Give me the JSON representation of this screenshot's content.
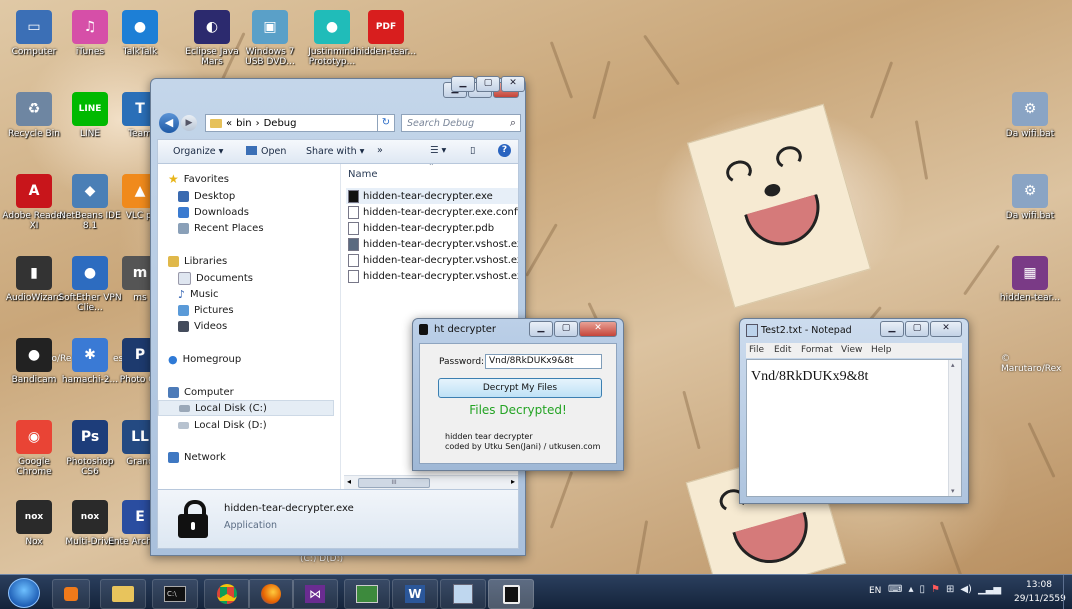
{
  "desktop_icons": [
    {
      "label": "Computer",
      "color": "#3b6fb6",
      "glyph": "▭"
    },
    {
      "label": "iTunes",
      "color": "#d64fa8",
      "glyph": "♫"
    },
    {
      "label": "TalkTalk",
      "color": "#1d7fd6",
      "glyph": "●"
    },
    {
      "label": "Eclipse Java Mars",
      "color": "#2c2a6e",
      "glyph": "◐"
    },
    {
      "label": "Windows 7 USB DVD...",
      "color": "#5aa0c8",
      "glyph": "▣"
    },
    {
      "label": "Justinmind Prototyp...",
      "color": "#20bcb9",
      "glyph": "●"
    },
    {
      "label": "hidden-tear...",
      "color": "#d81e1e",
      "glyph": "PDF"
    },
    {
      "label": "Recycle Bin",
      "color": "#6e86a2",
      "glyph": "♻"
    },
    {
      "label": "LINE",
      "color": "#00b900",
      "glyph": "LINE"
    },
    {
      "label": "Team",
      "color": "#2a6fb8",
      "glyph": "T"
    },
    {
      "label": "Adobe Reader XI",
      "color": "#c8151b",
      "glyph": "A"
    },
    {
      "label": "NetBeans IDE 8.1",
      "color": "#4a7fb6",
      "glyph": "◆"
    },
    {
      "label": "VLC pl",
      "color": "#f08a1c",
      "glyph": "▲"
    },
    {
      "label": "AudioWizard",
      "color": "#333333",
      "glyph": "▮"
    },
    {
      "label": "SoftEther VPN Clie...",
      "color": "#2d6cc0",
      "glyph": "●"
    },
    {
      "label": "ms",
      "color": "#555555",
      "glyph": "m"
    },
    {
      "label": "Bandicam",
      "color": "#222222",
      "glyph": "●"
    },
    {
      "label": "hamachi-2...",
      "color": "#3a7ad5",
      "glyph": "✱"
    },
    {
      "label": "Photo CS",
      "color": "#1d3a6e",
      "glyph": "P"
    },
    {
      "label": "Google Chrome",
      "color": "#e94435",
      "glyph": "◉"
    },
    {
      "label": "Photoshop CS6",
      "color": "#1d3d7a",
      "glyph": "Ps"
    },
    {
      "label": "Grand",
      "color": "#244a82",
      "glyph": "LL"
    },
    {
      "label": "Nox",
      "color": "#2a2a2a",
      "glyph": "nox"
    },
    {
      "label": "Multi-Drive",
      "color": "#2a2a2a",
      "glyph": "nox"
    },
    {
      "label": "Ente Architect",
      "color": "#2a4da0",
      "glyph": "E"
    },
    {
      "label": "Da wifi.bat",
      "color": "#8aa4c4",
      "glyph": "⚙"
    },
    {
      "label": "Da wifi.bat",
      "color": "#8aa4c4",
      "glyph": "⚙"
    },
    {
      "label": "hidden-tear...",
      "color": "#7a3a86",
      "glyph": "▦"
    }
  ],
  "watermarks": [
    "© Marutaro/Rex",
    "ro/Re",
    "es"
  ],
  "explorer": {
    "breadcrumb": [
      "«",
      "bin",
      "›",
      "Debug"
    ],
    "search_placeholder": "Search Debug",
    "toolbar": {
      "organize": "Organize ▾",
      "open": "Open",
      "share_with": "Share with ▾",
      "more": "»"
    },
    "column_header": "Name",
    "nav": {
      "favorites": "Favorites",
      "favorites_items": [
        "Desktop",
        "Downloads",
        "Recent Places"
      ],
      "libraries": "Libraries",
      "libraries_items": [
        "Documents",
        "Music",
        "Pictures",
        "Videos"
      ],
      "homegroup": "Homegroup",
      "computer": "Computer",
      "computer_items": [
        "Local Disk (C:)",
        "Local Disk (D:)"
      ],
      "network": "Network"
    },
    "files": [
      "hidden-tear-decrypter.exe",
      "hidden-tear-decrypter.exe.config",
      "hidden-tear-decrypter.pdb",
      "hidden-tear-decrypter.vshost.exe",
      "hidden-tear-decrypter.vshost.exe.conf",
      "hidden-tear-decrypter.vshost.exe.man"
    ],
    "details": {
      "name": "hidden-tear-decrypter.exe",
      "type": "Application"
    },
    "hscroll_thumb": "III"
  },
  "decrypter": {
    "title": "ht decrypter",
    "password_label": "Password:",
    "password_value": "Vnd/8RkDUKx9&8t",
    "button_label": "Decrypt My Files",
    "status": "Files Decrypted!",
    "credits_line1": "hidden tear decrypter",
    "credits_line2": "coded by Utku Sen(Jani) / utkusen.com"
  },
  "notepad": {
    "title": "Test2.txt - Notepad",
    "menu": [
      "File",
      "Edit",
      "Format",
      "View",
      "Help"
    ],
    "content": "Vnd/8RkDUKx9&8t"
  },
  "background_labels": [
    "(C:) D(D:)"
  ],
  "taskbar": {
    "language": "EN",
    "time": "13:08",
    "date": "29/11/2559"
  },
  "colors": {
    "taskbar": "#1c2b44",
    "status_green": "#23a323",
    "selection": "#cde4f7"
  }
}
